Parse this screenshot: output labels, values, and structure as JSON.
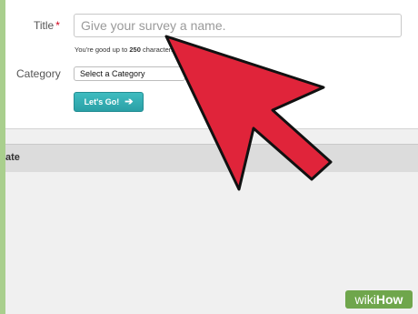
{
  "form": {
    "title_label": "Title",
    "required_mark": "*",
    "title_placeholder": "Give your survey a name.",
    "helper_prefix": "You're good up to",
    "helper_count": "250",
    "helper_suffix": "characters.",
    "category_label": "Category",
    "category_selected": "Select a Category",
    "go_button_label": "Let's Go!",
    "go_button_icon": "arrow-right-icon"
  },
  "table": {
    "header_text": "ate"
  },
  "overlay": {
    "pointer": "cursor-arrow-icon",
    "pointer_color": "#e0243a"
  },
  "watermark": {
    "brand": "wikiHow",
    "brand_color": "#6fa64c"
  }
}
